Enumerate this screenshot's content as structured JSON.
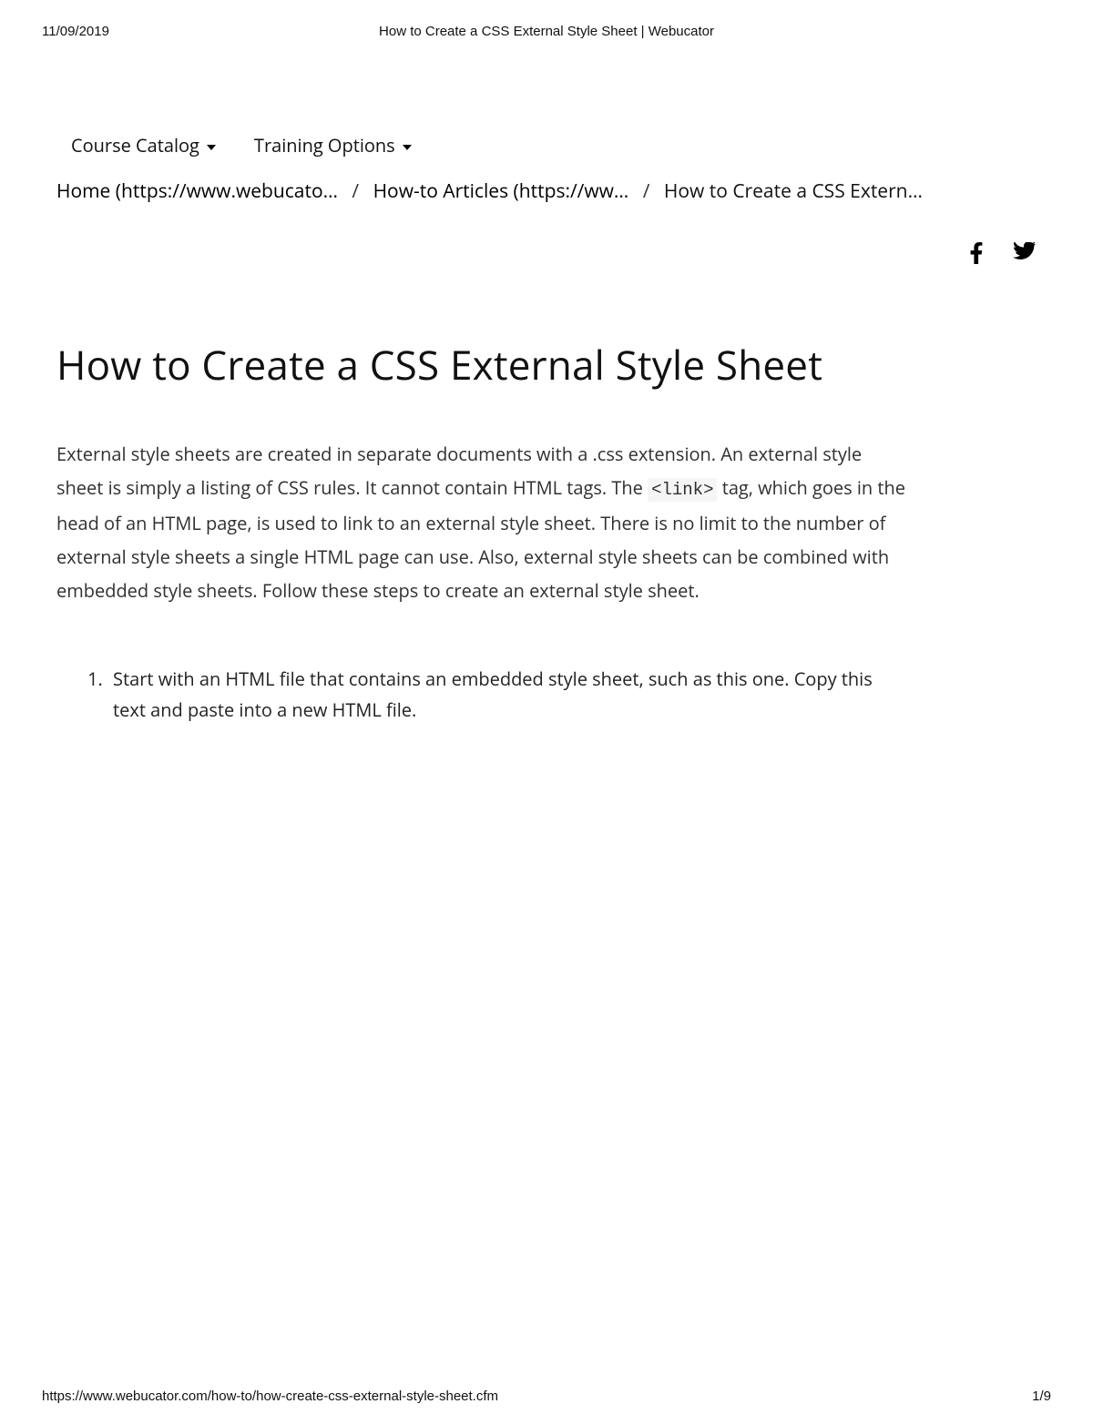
{
  "print": {
    "date": "11/09/2019",
    "header_title": "How to Create a CSS External Style Sheet | Webucator",
    "footer_url": "https://www.webucator.com/how-to/how-create-css-external-style-sheet.cfm",
    "page_indicator": "1/9"
  },
  "nav": {
    "items": [
      {
        "label": "Course Catalog"
      },
      {
        "label": "Training Options"
      }
    ]
  },
  "breadcrumb": {
    "home": "Home (https://www.webucato…",
    "howto": "How-to Articles (https://ww…",
    "current": "How to Create a CSS Extern…",
    "sep": "/"
  },
  "article": {
    "title": "How to Create a CSS External Style Sheet",
    "intro_a": "External style sheets are created in separate documents with a .css extension. An external style sheet is simply a listing of CSS rules. It cannot contain HTML tags. The ",
    "intro_code": "<link>",
    "intro_b": " tag, which goes in the head of an HTML page, is used to link to an external style sheet. There is no limit to the number of external style sheets a single HTML page can use. Also, external style sheets can be combined with embedded style sheets. Follow these steps to create an external style sheet.",
    "steps": [
      "Start with an HTML file that contains an embedded style sheet, such as this one. Copy this text and paste into a new HTML file."
    ]
  }
}
